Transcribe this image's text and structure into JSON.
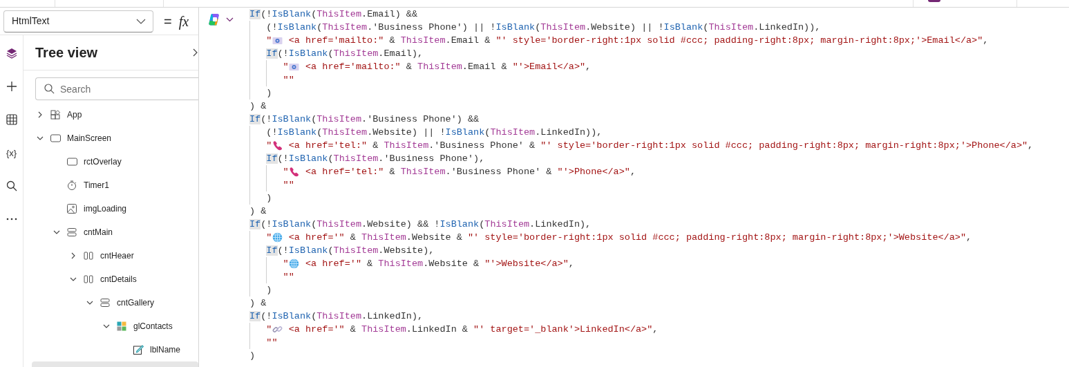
{
  "formula_bar": {
    "property": "HtmlText",
    "equals": "=",
    "fx": "fx"
  },
  "rail": [
    {
      "kind": "layers",
      "selected": true
    },
    {
      "kind": "plus",
      "selected": false
    },
    {
      "kind": "table",
      "selected": false
    },
    {
      "kind": "variables",
      "label": "{x}",
      "selected": false
    },
    {
      "kind": "search",
      "selected": false
    },
    {
      "kind": "more",
      "selected": false
    }
  ],
  "tree_view": {
    "title": "Tree view",
    "search": {
      "placeholder": "Search"
    },
    "items": [
      {
        "label": "App",
        "kind": "app",
        "expanded": false
      },
      {
        "label": "MainScreen",
        "kind": "screen",
        "expanded": true,
        "children": [
          {
            "label": "rctOverlay",
            "kind": "rectangle"
          },
          {
            "label": "Timer1",
            "kind": "timer"
          },
          {
            "label": "imgLoading",
            "kind": "image"
          },
          {
            "label": "cntMain",
            "kind": "vcontainer",
            "expanded": true,
            "children": [
              {
                "label": "cntHeaer",
                "kind": "hcontainer",
                "expanded": false
              },
              {
                "label": "cntDetails",
                "kind": "hcontainer",
                "expanded": true,
                "children": [
                  {
                    "label": "cntGallery",
                    "kind": "vcontainer",
                    "expanded": true,
                    "children": [
                      {
                        "label": "glContacts",
                        "kind": "gallery",
                        "expanded": true,
                        "children": [
                          {
                            "label": "lblName",
                            "kind": "label"
                          }
                        ]
                      }
                    ]
                  }
                ]
              }
            ]
          }
        ]
      }
    ]
  },
  "code_lines": [
    [
      {
        "kind": "kwhl",
        "text": "If"
      },
      {
        "kind": "txt",
        "text": "(!"
      },
      {
        "kind": "kw",
        "text": "IsBlank"
      },
      {
        "kind": "txt",
        "text": "("
      },
      {
        "kind": "obj",
        "text": "ThisItem"
      },
      {
        "kind": "txt",
        "text": ".Email) &&"
      }
    ],
    [
      {
        "kind": "txt",
        "text": "   (!"
      },
      {
        "kind": "kw",
        "text": "IsBlank"
      },
      {
        "kind": "txt",
        "text": "("
      },
      {
        "kind": "obj",
        "text": "ThisItem"
      },
      {
        "kind": "txt",
        "text": ".'Business Phone') || !"
      },
      {
        "kind": "kw",
        "text": "IsBlank"
      },
      {
        "kind": "txt",
        "text": "("
      },
      {
        "kind": "obj",
        "text": "ThisItem"
      },
      {
        "kind": "txt",
        "text": ".Website) || !"
      },
      {
        "kind": "kw",
        "text": "IsBlank"
      },
      {
        "kind": "txt",
        "text": "("
      },
      {
        "kind": "obj",
        "text": "ThisItem"
      },
      {
        "kind": "txt",
        "text": ".LinkedIn)),"
      }
    ],
    [
      {
        "kind": "str",
        "text": "   \""
      },
      {
        "kind": "mail"
      },
      {
        "kind": "str",
        "text": " <a href='mailto:\""
      },
      {
        "kind": "txt",
        "text": " & "
      },
      {
        "kind": "obj",
        "text": "ThisItem"
      },
      {
        "kind": "txt",
        "text": ".Email & "
      },
      {
        "kind": "str",
        "text": "\"' style='border-right:1px solid #ccc; padding-right:8px; margin-right:8px;'>Email</a>\""
      },
      {
        "kind": "txt",
        "text": ","
      }
    ],
    [
      {
        "kind": "kwhl",
        "text": "   If"
      },
      {
        "kind": "txt",
        "text": "(!"
      },
      {
        "kind": "kw",
        "text": "IsBlank"
      },
      {
        "kind": "txt",
        "text": "("
      },
      {
        "kind": "obj",
        "text": "ThisItem"
      },
      {
        "kind": "txt",
        "text": ".Email),"
      }
    ],
    [
      {
        "kind": "str",
        "text": "      \""
      },
      {
        "kind": "mail"
      },
      {
        "kind": "str",
        "text": " <a href='mailto:\""
      },
      {
        "kind": "txt",
        "text": " & "
      },
      {
        "kind": "obj",
        "text": "ThisItem"
      },
      {
        "kind": "txt",
        "text": ".Email & "
      },
      {
        "kind": "str",
        "text": "\"'>Email</a>\""
      },
      {
        "kind": "txt",
        "text": ","
      }
    ],
    [
      {
        "kind": "str",
        "text": "      \"\""
      }
    ],
    [
      {
        "kind": "txt",
        "text": "   )"
      }
    ],
    [
      {
        "kind": "txt",
        "text": ") &"
      }
    ],
    [
      {
        "kind": "kwhl",
        "text": "If"
      },
      {
        "kind": "txt",
        "text": "(!"
      },
      {
        "kind": "kw",
        "text": "IsBlank"
      },
      {
        "kind": "txt",
        "text": "("
      },
      {
        "kind": "obj",
        "text": "ThisItem"
      },
      {
        "kind": "txt",
        "text": ".'Business Phone') &&"
      }
    ],
    [
      {
        "kind": "txt",
        "text": "   (!"
      },
      {
        "kind": "kw",
        "text": "IsBlank"
      },
      {
        "kind": "txt",
        "text": "("
      },
      {
        "kind": "obj",
        "text": "ThisItem"
      },
      {
        "kind": "txt",
        "text": ".Website) || !"
      },
      {
        "kind": "kw",
        "text": "IsBlank"
      },
      {
        "kind": "txt",
        "text": "("
      },
      {
        "kind": "obj",
        "text": "ThisItem"
      },
      {
        "kind": "txt",
        "text": ".LinkedIn)),"
      }
    ],
    [
      {
        "kind": "str",
        "text": "   \""
      },
      {
        "kind": "phone"
      },
      {
        "kind": "str",
        "text": " <a href='tel:\""
      },
      {
        "kind": "txt",
        "text": " & "
      },
      {
        "kind": "obj",
        "text": "ThisItem"
      },
      {
        "kind": "txt",
        "text": ".'Business Phone' & "
      },
      {
        "kind": "str",
        "text": "\"' style='border-right:1px solid #ccc; padding-right:8px; margin-right:8px;'>Phone</a>\""
      },
      {
        "kind": "txt",
        "text": ","
      }
    ],
    [
      {
        "kind": "kwhl",
        "text": "   If"
      },
      {
        "kind": "txt",
        "text": "(!"
      },
      {
        "kind": "kw",
        "text": "IsBlank"
      },
      {
        "kind": "txt",
        "text": "("
      },
      {
        "kind": "obj",
        "text": "ThisItem"
      },
      {
        "kind": "txt",
        "text": ".'Business Phone'),"
      }
    ],
    [
      {
        "kind": "str",
        "text": "      \""
      },
      {
        "kind": "phone"
      },
      {
        "kind": "str",
        "text": " <a href='tel:\""
      },
      {
        "kind": "txt",
        "text": " & "
      },
      {
        "kind": "obj",
        "text": "ThisItem"
      },
      {
        "kind": "txt",
        "text": ".'Business Phone' & "
      },
      {
        "kind": "str",
        "text": "\"'>Phone</a>\""
      },
      {
        "kind": "txt",
        "text": ","
      }
    ],
    [
      {
        "kind": "str",
        "text": "      \"\""
      }
    ],
    [
      {
        "kind": "txt",
        "text": "   )"
      }
    ],
    [
      {
        "kind": "txt",
        "text": ") &"
      }
    ],
    [
      {
        "kind": "kwhl",
        "text": "If"
      },
      {
        "kind": "txt",
        "text": "(!"
      },
      {
        "kind": "kw",
        "text": "IsBlank"
      },
      {
        "kind": "txt",
        "text": "("
      },
      {
        "kind": "obj",
        "text": "ThisItem"
      },
      {
        "kind": "txt",
        "text": ".Website) && !"
      },
      {
        "kind": "kw",
        "text": "IsBlank"
      },
      {
        "kind": "txt",
        "text": "("
      },
      {
        "kind": "obj",
        "text": "ThisItem"
      },
      {
        "kind": "txt",
        "text": ".LinkedIn),"
      }
    ],
    [
      {
        "kind": "str",
        "text": "   \""
      },
      {
        "kind": "globe"
      },
      {
        "kind": "str",
        "text": " <a href='\""
      },
      {
        "kind": "txt",
        "text": " & "
      },
      {
        "kind": "obj",
        "text": "ThisItem"
      },
      {
        "kind": "txt",
        "text": ".Website & "
      },
      {
        "kind": "str",
        "text": "\"' style='border-right:1px solid #ccc; padding-right:8px; margin-right:8px;'>Website</a>\""
      },
      {
        "kind": "txt",
        "text": ","
      }
    ],
    [
      {
        "kind": "kwhl",
        "text": "   If"
      },
      {
        "kind": "txt",
        "text": "(!"
      },
      {
        "kind": "kw",
        "text": "IsBlank"
      },
      {
        "kind": "txt",
        "text": "("
      },
      {
        "kind": "obj",
        "text": "ThisItem"
      },
      {
        "kind": "txt",
        "text": ".Website),"
      }
    ],
    [
      {
        "kind": "str",
        "text": "      \""
      },
      {
        "kind": "globe"
      },
      {
        "kind": "str",
        "text": " <a href='\""
      },
      {
        "kind": "txt",
        "text": " & "
      },
      {
        "kind": "obj",
        "text": "ThisItem"
      },
      {
        "kind": "txt",
        "text": ".Website & "
      },
      {
        "kind": "str",
        "text": "\"'>Website</a>\""
      },
      {
        "kind": "txt",
        "text": ","
      }
    ],
    [
      {
        "kind": "str",
        "text": "      \"\""
      }
    ],
    [
      {
        "kind": "txt",
        "text": "   )"
      }
    ],
    [
      {
        "kind": "txt",
        "text": ") &"
      }
    ],
    [
      {
        "kind": "kwhl",
        "text": "If"
      },
      {
        "kind": "txt",
        "text": "(!"
      },
      {
        "kind": "kw",
        "text": "IsBlank"
      },
      {
        "kind": "txt",
        "text": "("
      },
      {
        "kind": "obj",
        "text": "ThisItem"
      },
      {
        "kind": "txt",
        "text": ".LinkedIn),"
      }
    ],
    [
      {
        "kind": "str",
        "text": "   \""
      },
      {
        "kind": "link"
      },
      {
        "kind": "str",
        "text": " <a href='\""
      },
      {
        "kind": "txt",
        "text": " & "
      },
      {
        "kind": "obj",
        "text": "ThisItem"
      },
      {
        "kind": "txt",
        "text": ".LinkedIn & "
      },
      {
        "kind": "str",
        "text": "\"' target='_blank'>LinkedIn</a>\""
      },
      {
        "kind": "txt",
        "text": ","
      }
    ],
    [
      {
        "kind": "str",
        "text": "   \"\""
      }
    ],
    [
      {
        "kind": "txt",
        "text": ")"
      }
    ]
  ]
}
